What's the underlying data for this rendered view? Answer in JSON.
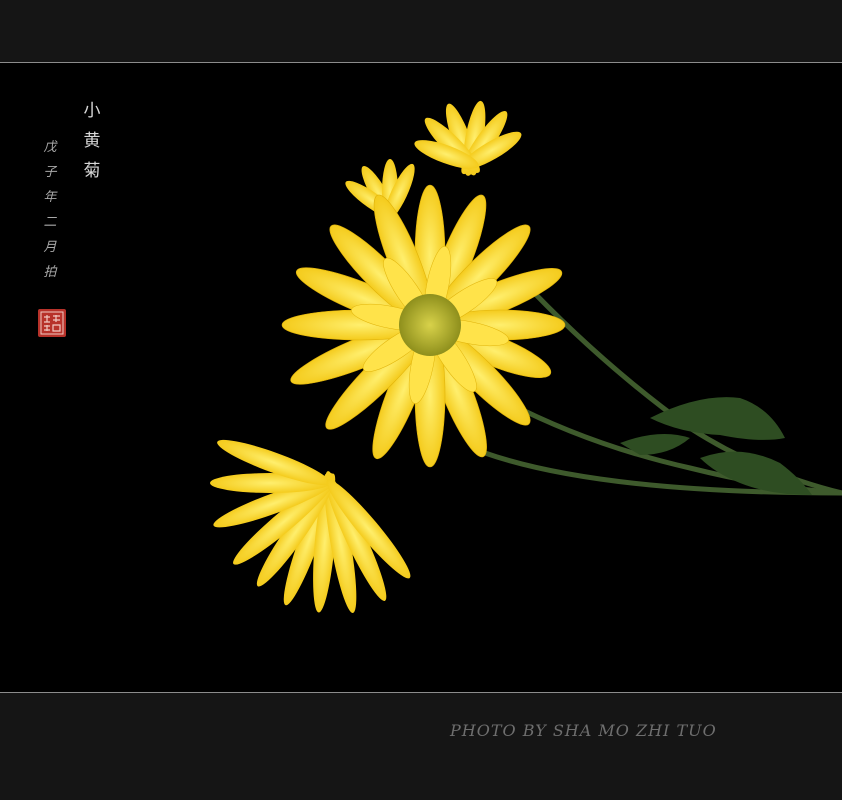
{
  "title_chars": [
    "小",
    "黄",
    "菊"
  ],
  "date_chars": [
    "戊",
    "子",
    "年",
    "二",
    "月",
    "拍"
  ],
  "seal": "stamp",
  "credit": "PHOTO BY SHA MO ZHI TUO",
  "colors": {
    "petal": "#f6d21a",
    "petal_light": "#ffe95a",
    "center": "#b5b52b",
    "stem": "#3d5a2a",
    "seal": "#b7322a",
    "background": "#000000"
  }
}
